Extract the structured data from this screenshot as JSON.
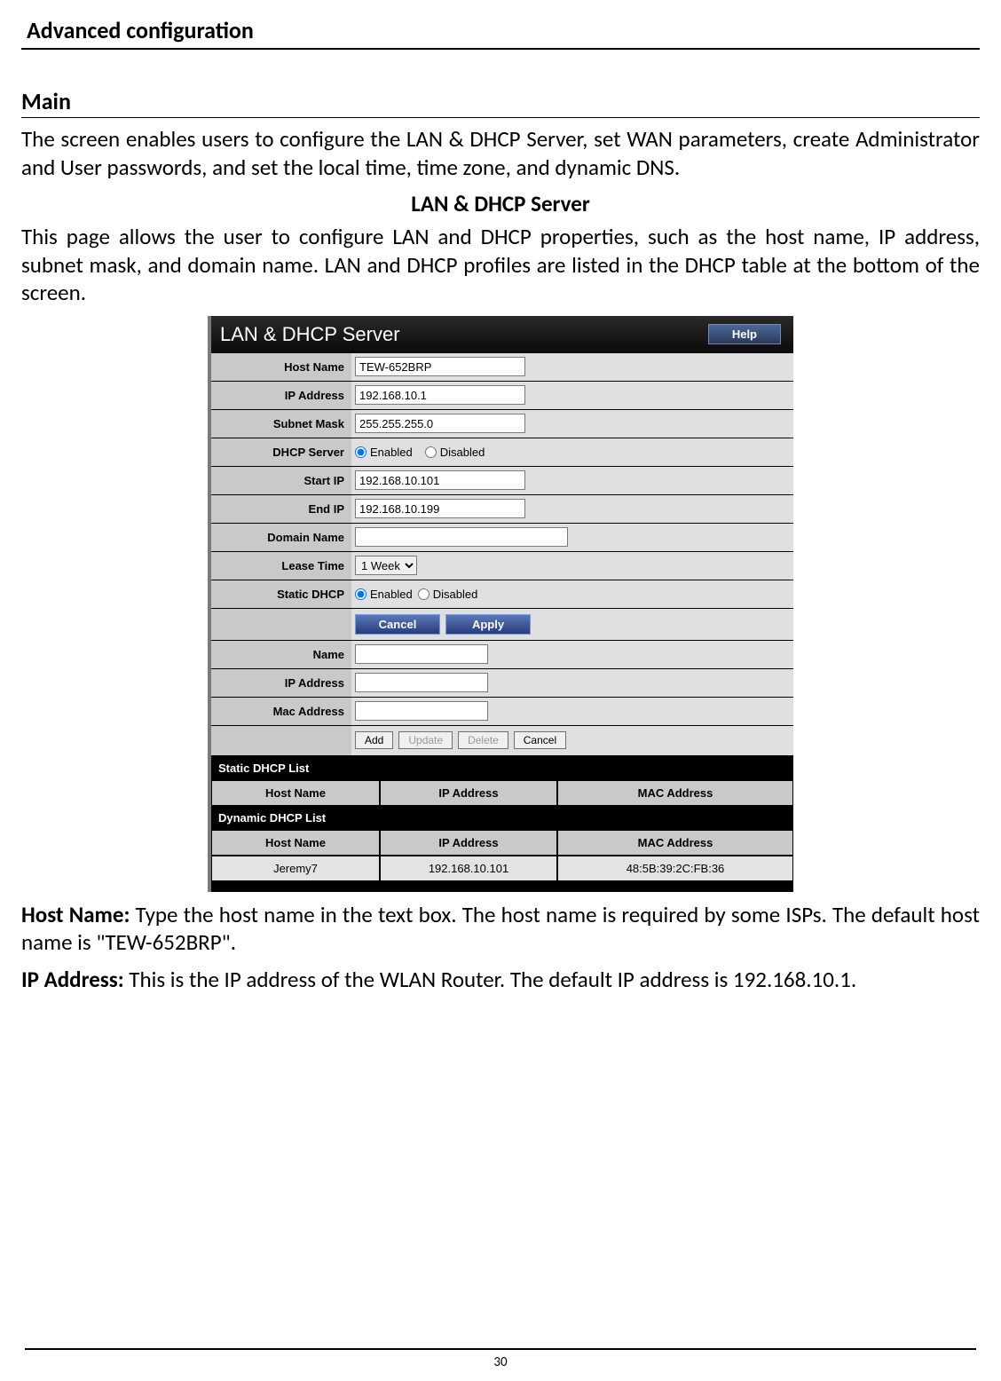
{
  "page": {
    "header": "Advanced configuration",
    "number": "30"
  },
  "main": {
    "heading": "Main",
    "intro": "The screen enables users to configure the LAN & DHCP Server, set WAN parameters, create Administrator and User passwords, and set the local time, time zone, and dynamic DNS.",
    "sub_heading": "LAN & DHCP Server",
    "sub_intro": "This page allows the user to configure LAN and DHCP properties, such as the host name, IP address, subnet mask, and domain name. LAN and DHCP profiles are listed in the DHCP table at the bottom of the screen."
  },
  "panel": {
    "title": "LAN & DHCP Server",
    "help": "Help",
    "fields": {
      "host_name_lbl": "Host Name",
      "host_name_val": "TEW-652BRP",
      "ip_address_lbl": "IP Address",
      "ip_address_val": "192.168.10.1",
      "subnet_mask_lbl": "Subnet Mask",
      "subnet_mask_val": "255.255.255.0",
      "dhcp_server_lbl": "DHCP Server",
      "enabled": "Enabled",
      "disabled": "Disabled",
      "start_ip_lbl": "Start IP",
      "start_ip_val": "192.168.10.101",
      "end_ip_lbl": "End IP",
      "end_ip_val": "192.168.10.199",
      "domain_name_lbl": "Domain Name",
      "domain_name_val": "",
      "lease_time_lbl": "Lease Time",
      "lease_time_val": "1 Week",
      "static_dhcp_lbl": "Static DHCP",
      "cancel": "Cancel",
      "apply": "Apply",
      "name_lbl": "Name",
      "ip_address2_lbl": "IP Address",
      "mac_address_lbl": "Mac Address",
      "add": "Add",
      "update": "Update",
      "delete": "Delete",
      "cancel2": "Cancel"
    },
    "static_list": {
      "title": "Static DHCP List",
      "col1": "Host Name",
      "col2": "IP Address",
      "col3": "MAC Address"
    },
    "dynamic_list": {
      "title": "Dynamic DHCP List",
      "col1": "Host Name",
      "col2": "IP Address",
      "col3": "MAC Address",
      "row1": {
        "host": "Jeremy7",
        "ip": "192.168.10.101",
        "mac": "48:5B:39:2C:FB:36"
      }
    }
  },
  "desc": {
    "host_name_bold": "Host Name: ",
    "host_name_text": "Type the host name in the text box. The host name is required by some ISPs. The default host name is \"TEW-652BRP\".",
    "ip_address_bold": "IP Address: ",
    "ip_address_text": "This is the IP address of the WLAN Router. The default IP address is 192.168.10.1."
  }
}
